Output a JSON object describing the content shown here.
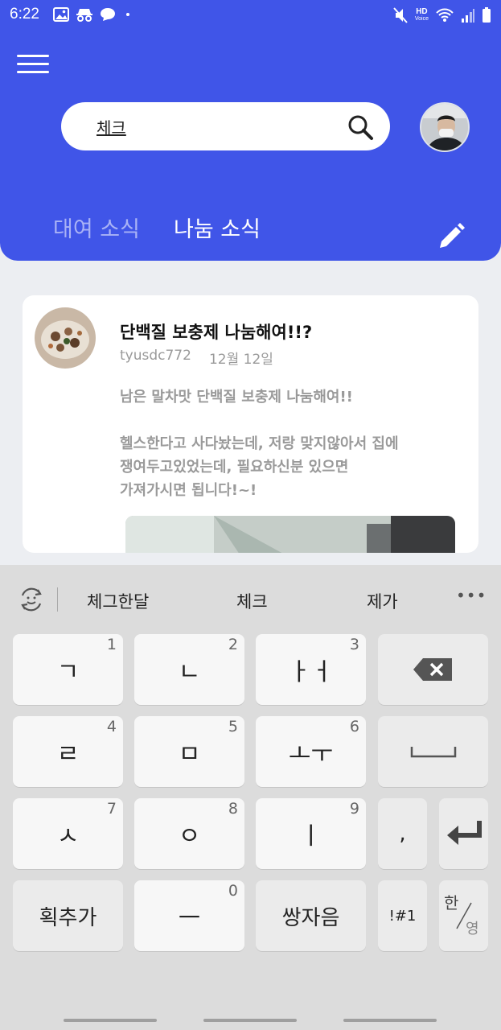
{
  "status_bar": {
    "time": "6:22",
    "left_icons": [
      "image-icon",
      "incognito-icon",
      "chat-bubble-icon",
      "dot-icon"
    ],
    "right_icons": [
      "mute-icon",
      "hd-voice-icon",
      "wifi-icon",
      "signal-icon",
      "battery-icon"
    ],
    "hd_label": "HD",
    "voice_label": "Voice"
  },
  "header": {
    "menu_icon": "hamburger-menu-icon",
    "search": {
      "value": "체크",
      "placeholder": ""
    },
    "tabs": [
      {
        "label": "대여 소식",
        "active": false
      },
      {
        "label": "나눔 소식",
        "active": true
      }
    ],
    "edit_icon": "pencil-icon",
    "colors": {
      "primary": "#4055e8",
      "tab_inactive": "#a9b2f6"
    }
  },
  "post": {
    "title": "단백질 보충제 나눔해여!!?",
    "author": "tyusdc772",
    "date": "12월 12일",
    "body": [
      "남은 말차맛 단백질 보충제 나눔해여!!",
      "",
      "헬스한다고 사다놨는데, 저랑 맞지않아서 집에",
      "쟁여두고있었는데, 필요하신분 있으면",
      "가져가시면 됩니다!~!"
    ]
  },
  "keyboard": {
    "suggestions": [
      "체그한달",
      "체크",
      "제가"
    ],
    "rows": [
      [
        {
          "ch": "ㄱ",
          "num": "1"
        },
        {
          "ch": "ㄴ",
          "num": "2"
        },
        {
          "ch": "ㅏㅓ",
          "num": "3"
        },
        {
          "ch": "backspace",
          "num": ""
        }
      ],
      [
        {
          "ch": "ㄹ",
          "num": "4"
        },
        {
          "ch": "ㅁ",
          "num": "5"
        },
        {
          "ch": "ㅗㅜ",
          "num": "6"
        },
        {
          "ch": "space",
          "num": ""
        }
      ],
      [
        {
          "ch": "ㅅ",
          "num": "7"
        },
        {
          "ch": "ㅇ",
          "num": "8"
        },
        {
          "ch": "ㅣ",
          "num": "9"
        },
        {
          "ch": ",",
          "num": ""
        },
        {
          "ch": "enter",
          "num": ""
        }
      ],
      [
        {
          "ch": "획추가",
          "num": ""
        },
        {
          "ch": "ㅡ",
          "num": "0"
        },
        {
          "ch": "쌍자음",
          "num": ""
        },
        {
          "ch": "!#1",
          "num": ""
        },
        {
          "ch": "한/영",
          "num": ""
        }
      ]
    ],
    "lang_top": "한",
    "lang_bottom": "영"
  }
}
